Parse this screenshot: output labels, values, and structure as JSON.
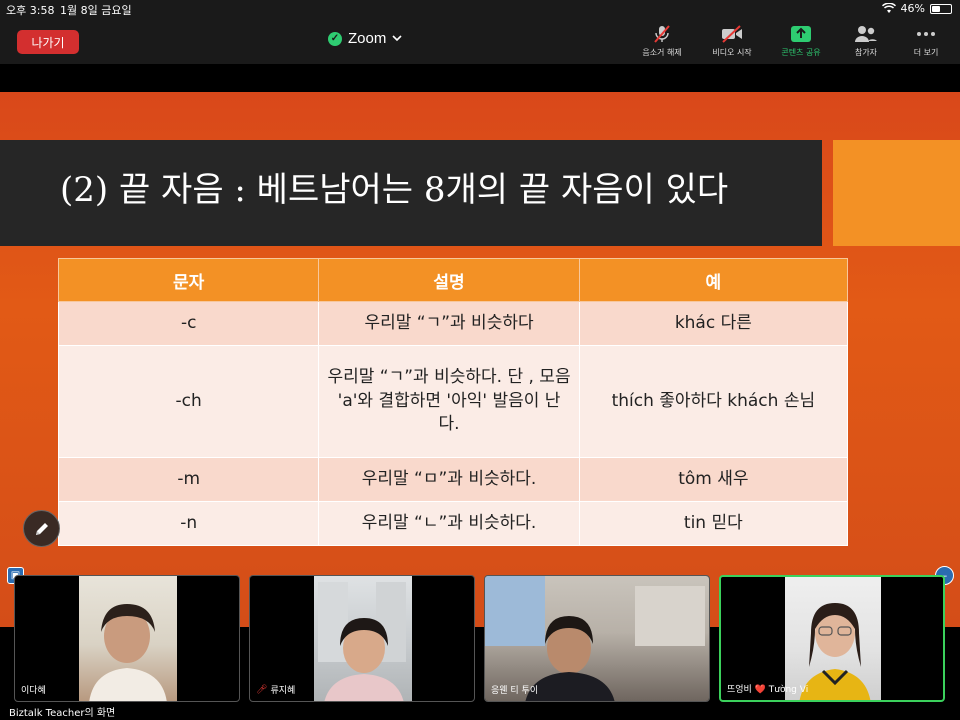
{
  "status_bar": {
    "time": "오후 3:58",
    "date": "1월 8일 금요일",
    "battery_percent": "46%",
    "battery_level": 0.46
  },
  "toolbar": {
    "leave_label": "나가기",
    "app_title": "Zoom",
    "items": [
      {
        "label": "음소거 해제",
        "icon": "mic-muted-icon"
      },
      {
        "label": "비디오 시작",
        "icon": "video-off-icon"
      },
      {
        "label": "콘텐츠 공유",
        "icon": "share-screen-icon"
      },
      {
        "label": "참가자",
        "icon": "participants-icon"
      },
      {
        "label": "더 보기",
        "icon": "more-icon"
      }
    ]
  },
  "slide": {
    "title": "(2) 끝 자음 : 베트남어는 8개의 끝 자음이 있다",
    "table": {
      "headers": [
        "문자",
        "설명",
        "예"
      ],
      "rows": [
        [
          "-c",
          "우리말 “ㄱ”과 비슷하다",
          "khác 다른"
        ],
        [
          "-ch",
          "우리말 “ㄱ”과 비슷하다. 단 , 모음 'a'와 결합하면 '아익' 발음이 난다.",
          "thích 좋아하다 khách 손님"
        ],
        [
          "-m",
          "우리말 “ㅁ”과 비슷하다.",
          "tôm 새우"
        ],
        [
          "-n",
          "우리말 “ㄴ”과 비슷하다.",
          "tin 믿다"
        ]
      ]
    }
  },
  "participants": [
    {
      "name": "이다혜",
      "muted": false,
      "active": false
    },
    {
      "name": "류지혜",
      "muted": true,
      "active": false
    },
    {
      "name": "응웬 티 투이",
      "muted": false,
      "active": false
    },
    {
      "name": "뜨엉비 ❤️ Tường Vi",
      "muted": false,
      "active": true
    }
  ],
  "screen_label": "Biztalk Teacher의 화면"
}
